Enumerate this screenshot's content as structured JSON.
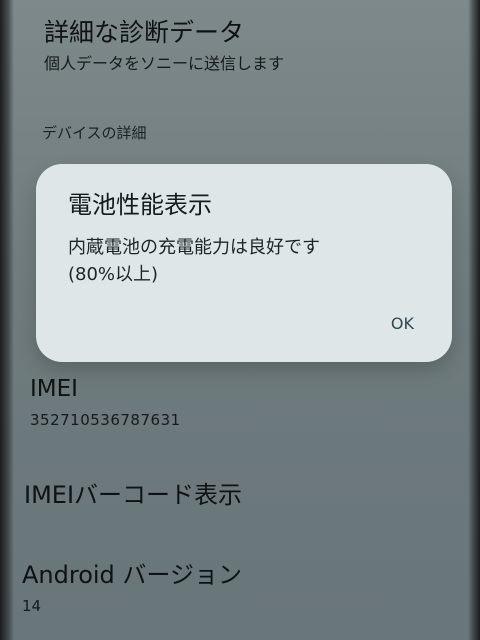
{
  "settings": {
    "diagnostics": {
      "title": "詳細な診断データ",
      "subtitle": "個人データをソニーに送信します"
    },
    "section_header": "デバイスの詳細",
    "imei": {
      "title": "IMEI",
      "value": "352710536787631"
    },
    "imei_barcode": {
      "title": "IMEIバーコード表示"
    },
    "android_version": {
      "title": "Android バージョン",
      "value": "14"
    }
  },
  "dialog": {
    "title": "電池性能表示",
    "message_line1": "内蔵電池の充電能力は良好です",
    "message_line2": "(80%以上)",
    "ok_label": "OK"
  },
  "colors": {
    "screen_background": "#747f82",
    "dialog_background": "#dfe6e7",
    "button_text": "#2c4a54"
  }
}
